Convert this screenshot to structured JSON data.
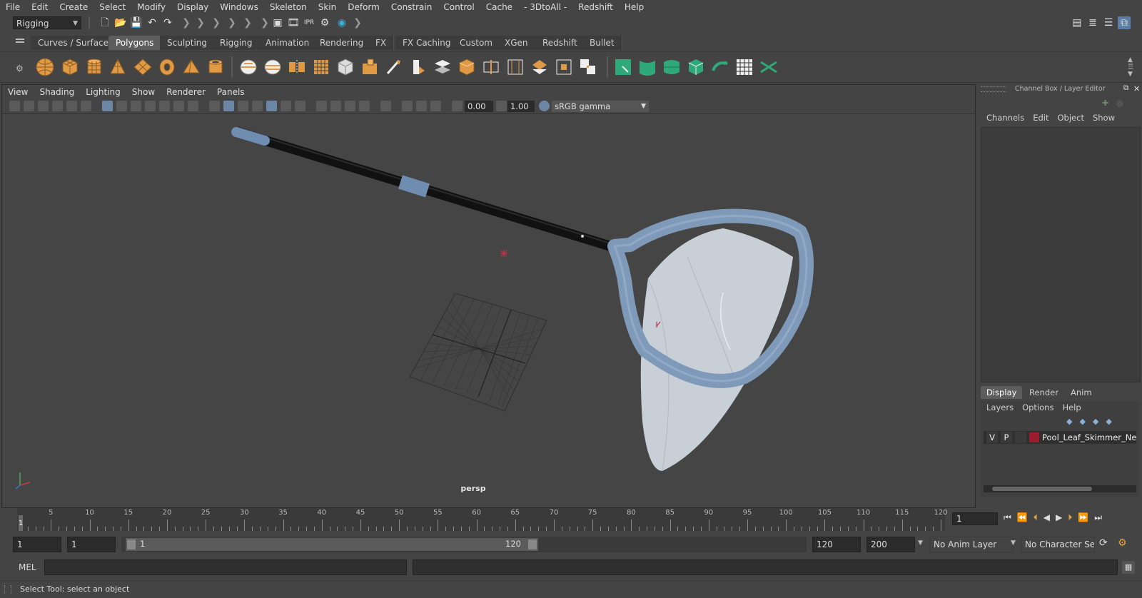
{
  "menu": [
    "File",
    "Edit",
    "Create",
    "Select",
    "Modify",
    "Display",
    "Windows",
    "Skeleton",
    "Skin",
    "Deform",
    "Constrain",
    "Control",
    "Cache",
    "- 3DtoAll -",
    "Redshift",
    "Help"
  ],
  "status_line": {
    "mode": "Rigging"
  },
  "shelf": {
    "tabs": [
      "Curves / Surfaces",
      "Polygons",
      "Sculpting",
      "Rigging",
      "Animation",
      "Rendering",
      "FX",
      "FX Caching",
      "Custom",
      "XGen",
      "Redshift",
      "Bullet"
    ],
    "active_tab": "Polygons"
  },
  "viewport": {
    "menu": [
      "View",
      "Shading",
      "Lighting",
      "Show",
      "Renderer",
      "Panels"
    ],
    "exposure": "0.00",
    "gamma": "1.00",
    "color_space": "sRGB gamma",
    "camera_label": "persp",
    "colors": {
      "net_frame": "#7f9ab9",
      "handle": "#111111",
      "grip": "#6f8db0",
      "net_mesh": "#c9cfd6",
      "background": "#454545"
    }
  },
  "channel_box": {
    "title": "Channel Box / Layer Editor",
    "menu": [
      "Channels",
      "Edit",
      "Object",
      "Show"
    ],
    "layer_tabs": [
      "Display",
      "Render",
      "Anim"
    ],
    "active_layer_tab": "Display",
    "layer_menu": [
      "Layers",
      "Options",
      "Help"
    ],
    "layers": [
      {
        "visible": "V",
        "playback": "P",
        "name": "Pool_Leaf_Skimmer_Net_",
        "color": "#9b1c2c"
      }
    ]
  },
  "timeline": {
    "ticks": [
      "5",
      "10",
      "15",
      "20",
      "25",
      "30",
      "35",
      "40",
      "45",
      "50",
      "55",
      "60",
      "65",
      "70",
      "75",
      "80",
      "85",
      "90",
      "95",
      "100",
      "105",
      "110",
      "115",
      "120"
    ],
    "start_frame": "1",
    "current_frame": "1",
    "current_frame_field": "1"
  },
  "range": {
    "start": "1",
    "playback_start": "1",
    "slider_start": "1",
    "slider_end": "120",
    "playback_end": "120",
    "end": "200",
    "anim_layer": "No Anim Layer",
    "character_set": "No Character Set"
  },
  "command_line": {
    "label": "MEL"
  },
  "help_line": "Select Tool: select an object"
}
